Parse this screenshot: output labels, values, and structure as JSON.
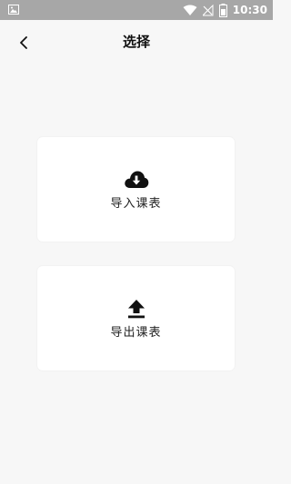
{
  "status_bar": {
    "time": "10:30",
    "background": "#a7a7a7"
  },
  "header": {
    "title": "选择",
    "back_icon": "chevron-left-icon"
  },
  "cards": {
    "import": {
      "label": "导入课表",
      "icon": "cloud-download-icon"
    },
    "export": {
      "label": "导出课表",
      "icon": "upload-icon"
    }
  },
  "colors": {
    "page_background": "#f7f7f7",
    "card_background": "#ffffff",
    "icon_color": "#111111"
  }
}
